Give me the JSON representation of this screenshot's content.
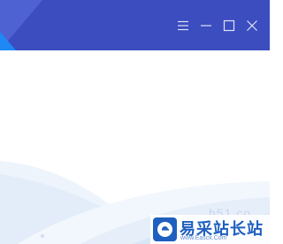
{
  "window": {
    "controls": [
      {
        "name": "menu-button",
        "icon": "hamburger-menu-icon"
      },
      {
        "name": "minimize-button",
        "icon": "minimize-icon"
      },
      {
        "name": "maximize-button",
        "icon": "maximize-icon"
      },
      {
        "name": "close-button",
        "icon": "close-icon"
      }
    ],
    "titlebar_color": "#3b4dbf",
    "accent_color": "#1e88f5"
  },
  "content": {
    "partial_text": "h51 co"
  },
  "watermark": {
    "title": "易采站长站",
    "url": "www.Easck.Com",
    "brand_color": "#1f5fbf"
  }
}
